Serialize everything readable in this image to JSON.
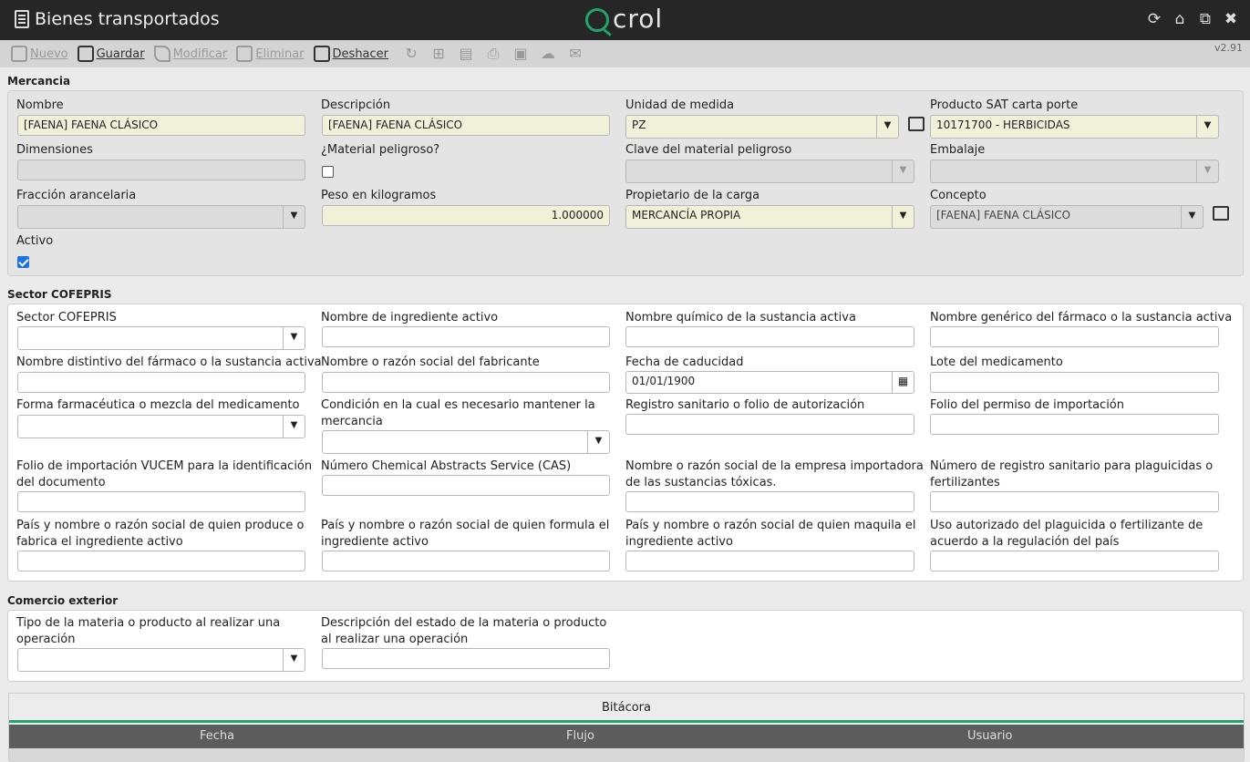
{
  "window": {
    "title": "Bienes transportados",
    "logo_text": "crol",
    "version": "v2.91"
  },
  "titlebar_icons": [
    "refresh-icon",
    "home-icon",
    "restore-window-icon",
    "close-icon"
  ],
  "toolbar": {
    "nuevo": "Nuevo",
    "guardar": "Guardar",
    "modificar": "Modificar",
    "eliminar": "Eliminar",
    "deshacer": "Deshacer"
  },
  "mercancia": {
    "title": "Mercancia",
    "nombre": {
      "label": "Nombre",
      "value": "[FAENA] FAENA CLÁSICO"
    },
    "descripcion": {
      "label": "Descripción",
      "value": "[FAENA] FAENA CLÁSICO"
    },
    "unidad": {
      "label": "Unidad de medida",
      "value": "PZ"
    },
    "producto_sat": {
      "label": "Producto SAT carta porte",
      "value": "10171700 - HERBICIDAS"
    },
    "dimensiones": {
      "label": "Dimensiones",
      "value": ""
    },
    "material_peligroso": {
      "label": "¿Material peligroso?",
      "checked": false
    },
    "clave_material": {
      "label": "Clave del material peligroso",
      "value": ""
    },
    "embalaje": {
      "label": "Embalaje",
      "value": ""
    },
    "fraccion": {
      "label": "Fracción arancelaria",
      "value": ""
    },
    "peso": {
      "label": "Peso en kilogramos",
      "value": "1.000000"
    },
    "propietario": {
      "label": "Propietario de la carga",
      "value": "MERCANCÍA PROPIA"
    },
    "concepto": {
      "label": "Concepto",
      "value": "[FAENA] FAENA CLÁSICO"
    },
    "activo": {
      "label": "Activo",
      "checked": true
    }
  },
  "cofepris": {
    "title": "Sector COFEPRIS",
    "sector": "Sector COFEPRIS",
    "ingrediente": "Nombre de ingrediente activo",
    "quimico": "Nombre químico de la sustancia activa",
    "generico": "Nombre genérico del fármaco o la sustancia activa",
    "distintivo": "Nombre distintivo del fármaco o la sustancia activa",
    "fabricante": "Nombre o razón social del fabricante",
    "caducidad": {
      "label": "Fecha de caducidad",
      "value": "01/01/1900"
    },
    "lote": "Lote del medicamento",
    "forma": "Forma farmacéutica o mezcla del medicamento",
    "condicion": "Condición en la cual es necesario mantener la mercancia",
    "registro": "Registro sanitario o folio de autorización",
    "folio_permiso": "Folio del permiso de importación",
    "folio_vucem": "Folio de importación VUCEM para la identificación del documento",
    "cas": "Número Chemical Abstracts Service (CAS)",
    "importadora": "Nombre o razón social de la empresa importadora de las sustancias tóxicas.",
    "registro_plaguicidas": "Número de registro sanitario para plaguicidas o fertilizantes",
    "produce": "País y nombre o razón social de quien produce o fabrica el ingrediente activo",
    "formula": "País y nombre o razón social de quien formula el ingrediente activo",
    "maquila": "País y nombre o razón social de quien maquila el ingrediente activo",
    "uso": "Uso autorizado del plaguicida o fertilizante de acuerdo a la regulación del país"
  },
  "comercio": {
    "title": "Comercio exterior",
    "tipo": "Tipo de la materia o producto al realizar una operación",
    "estado": "Descripción del estado de la materia o producto al realizar una operación"
  },
  "bitacora": {
    "title": "Bitácora",
    "columns": [
      "Fecha",
      "Flujo",
      "Usuario"
    ]
  }
}
